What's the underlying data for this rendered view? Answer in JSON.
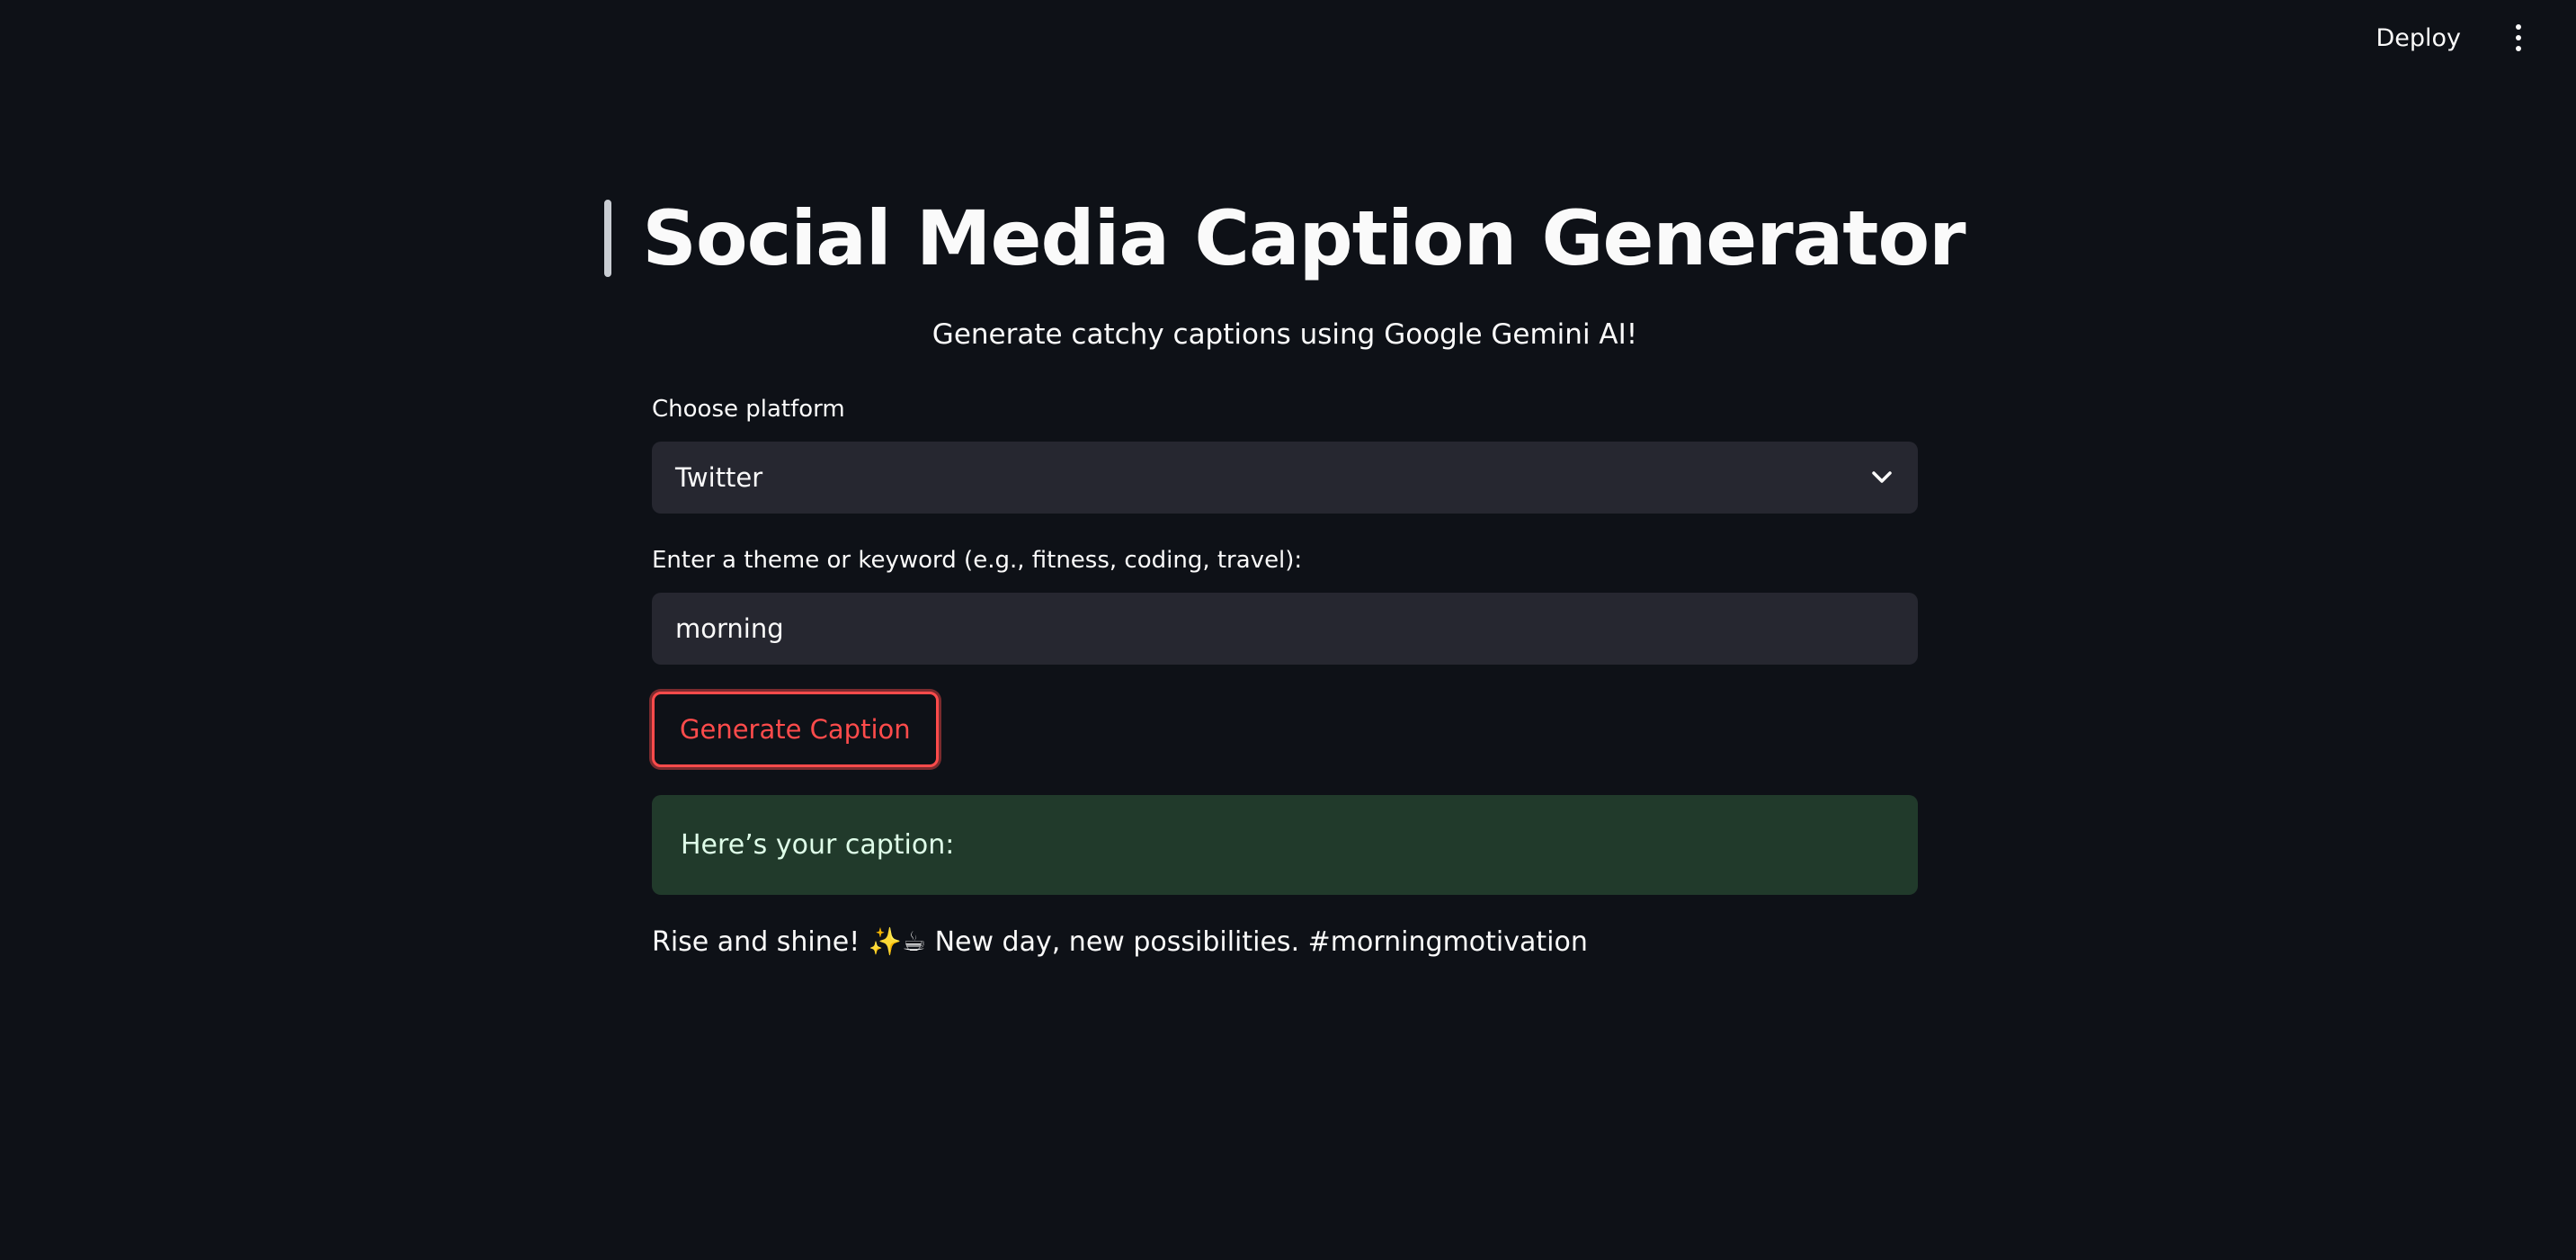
{
  "toolbar": {
    "deploy_label": "Deploy",
    "menu_icon": "kebab-menu-icon"
  },
  "header": {
    "title_icon": "mobile-phone-icon",
    "title": "Social Media Caption Generator",
    "subtitle": "Generate catchy captions using Google Gemini AI!"
  },
  "form": {
    "platform_label": "Choose platform",
    "platform_value": "Twitter",
    "theme_label": "Enter a theme or keyword (e.g., fitness, coding, travel):",
    "theme_value": "morning",
    "generate_label": "Generate Caption"
  },
  "result": {
    "success_message": "Here’s your caption:",
    "caption": "Rise and shine! ✨☕ New day, new possibilities. #morningmotivation"
  },
  "colors": {
    "background": "#0e1117",
    "input_background": "#262730",
    "accent": "#ff4b4b",
    "success_background": "#213a2b",
    "text": "#fafafa"
  }
}
